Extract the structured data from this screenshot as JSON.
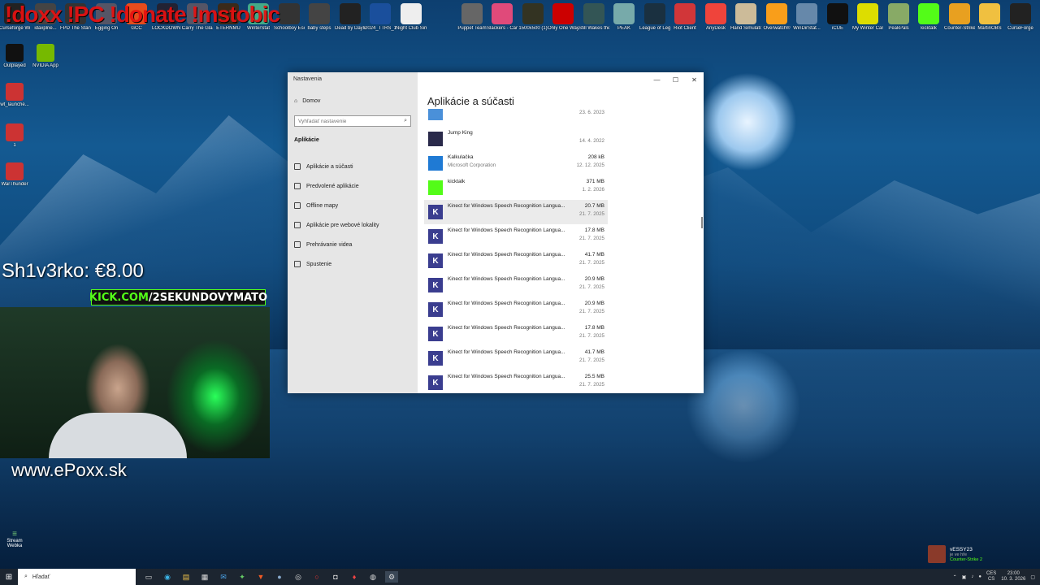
{
  "overlay": {
    "top_text": "!doxx !PC !donate !mstobic",
    "donation": "Sh1v3rko: €8.00",
    "kick_a": "KICK.COM",
    "kick_b": "/2SEKUNDOVYMATO",
    "website": "www.ePoxx.sk"
  },
  "desktop_icons": [
    {
      "label": "Curseforge Windows...",
      "color": "#222"
    },
    {
      "label": "idaxplne...",
      "color": "#444"
    },
    {
      "label": "FPD The Stanle...",
      "color": "#333"
    },
    {
      "label": "Egging On",
      "color": "#556"
    },
    {
      "label": "GCC",
      "color": "#e74c1c"
    },
    {
      "label": "LOCKDOWN Protocol",
      "color": "#223"
    },
    {
      "label": "Carry The Glass",
      "color": "#556"
    },
    {
      "label": "ETERNMU",
      "color": "#3a2a1a"
    },
    {
      "label": "WinterStat",
      "color": "#4a8"
    },
    {
      "label": "Schoolboy Escape 2...",
      "color": "#333"
    },
    {
      "label": "baby steps",
      "color": "#444"
    },
    {
      "label": "Dead by Daylight",
      "color": "#222"
    },
    {
      "label": "2024_TTRS_1",
      "color": "#1a4f9c"
    },
    {
      "label": "Night Club Simulator",
      "color": "#eee"
    },
    {
      "label": "Puppet Team",
      "color": "#666"
    },
    {
      "label": "Slackers - Carts of...",
      "color": "#e04a7a"
    },
    {
      "label": "1500x500 (1)",
      "color": "#332"
    },
    {
      "label": "Only One Way Up",
      "color": "#c00"
    },
    {
      "label": "Still Wakes the Deep",
      "color": "#355"
    },
    {
      "label": "PEAK",
      "color": "#7aa"
    },
    {
      "label": "League of Legends",
      "color": "#1a3040"
    },
    {
      "label": "Riot Client",
      "color": "#d13639"
    },
    {
      "label": "AnyDesk",
      "color": "#ef443b"
    },
    {
      "label": "Hand Simulator",
      "color": "#cb9"
    },
    {
      "label": "Overwatch®",
      "color": "#f99e1a"
    },
    {
      "label": "WinDirStat...",
      "color": "#68a"
    },
    {
      "label": "iCUE",
      "color": "#111"
    },
    {
      "label": "My Winter Car",
      "color": "#dd0"
    },
    {
      "label": "PeakPals",
      "color": "#8a6"
    },
    {
      "label": "kicktalk",
      "color": "#53fc18"
    },
    {
      "label": "Counter-Strike 2",
      "color": "#e8a020"
    },
    {
      "label": "MartinOBS",
      "color": "#f0c040"
    },
    {
      "label": "CurseForge",
      "color": "#222"
    }
  ],
  "left_icons": [
    {
      "label": "Outplayed",
      "color": "#111"
    },
    {
      "label": "NVIDIA App",
      "color": "#76b900"
    },
    {
      "label": "wt_launche...",
      "color": "#c33"
    },
    {
      "label": "1",
      "color": "#c33"
    },
    {
      "label": "WarThunder",
      "color": "#c33"
    }
  ],
  "window": {
    "title": "Nastavenia",
    "home": "Domov",
    "search_placeholder": "Vyhľadať nastavenie",
    "section": "Aplikácie",
    "nav": [
      "Aplikácie a súčasti",
      "Predvolené aplikácie",
      "Offline mapy",
      "Aplikácie pre webové lokality",
      "Prehrávanie videa",
      "Spustenie"
    ],
    "page_title": "Aplikácie a súčasti",
    "minimize": "—",
    "maximize": "☐",
    "close": "✕",
    "apps": [
      {
        "name": "",
        "publisher": "",
        "size": "",
        "date": "23. 6. 2023",
        "icon": "generic-app-icon",
        "color": "#4a90d9"
      },
      {
        "name": "Jump King",
        "publisher": "",
        "size": "",
        "date": "14. 4. 2022",
        "icon": "jump-king-icon",
        "color": "#2a2a4a"
      },
      {
        "name": "Kalkulačka",
        "publisher": "Microsoft Corporation",
        "size": "208 kB",
        "date": "12. 12. 2025",
        "icon": "calculator-icon",
        "color": "#1f7ad4"
      },
      {
        "name": "kicktalk",
        "publisher": "",
        "size": "371 MB",
        "date": "1. 2. 2026",
        "icon": "kicktalk-icon",
        "color": "#53fc18"
      },
      {
        "name": "Kinect for Windows Speech Recognition Langua...",
        "publisher": "",
        "size": "20.7 MB",
        "date": "21. 7. 2025",
        "icon": "kinect-icon",
        "color": "#3a3d8f"
      },
      {
        "name": "Kinect for Windows Speech Recognition Langua...",
        "publisher": "",
        "size": "17.8 MB",
        "date": "21. 7. 2025",
        "icon": "kinect-icon",
        "color": "#3a3d8f"
      },
      {
        "name": "Kinect for Windows Speech Recognition Langua...",
        "publisher": "",
        "size": "41.7 MB",
        "date": "21. 7. 2025",
        "icon": "kinect-icon",
        "color": "#3a3d8f"
      },
      {
        "name": "Kinect for Windows Speech Recognition Langua...",
        "publisher": "",
        "size": "20.9 MB",
        "date": "21. 7. 2025",
        "icon": "kinect-icon",
        "color": "#3a3d8f"
      },
      {
        "name": "Kinect for Windows Speech Recognition Langua...",
        "publisher": "",
        "size": "20.9 MB",
        "date": "21. 7. 2025",
        "icon": "kinect-icon",
        "color": "#3a3d8f"
      },
      {
        "name": "Kinect for Windows Speech Recognition Langua...",
        "publisher": "",
        "size": "17.8 MB",
        "date": "21. 7. 2025",
        "icon": "kinect-icon",
        "color": "#3a3d8f"
      },
      {
        "name": "Kinect for Windows Speech Recognition Langua...",
        "publisher": "",
        "size": "41.7 MB",
        "date": "21. 7. 2025",
        "icon": "kinect-icon",
        "color": "#3a3d8f"
      },
      {
        "name": "Kinect for Windows Speech Recognition Langua...",
        "publisher": "",
        "size": "25.5 MB",
        "date": "21. 7. 2025",
        "icon": "kinect-icon",
        "color": "#3a3d8f"
      }
    ]
  },
  "taskbar": {
    "search_placeholder": "Hľadať",
    "lang1": "CES",
    "lang2": "CS",
    "time": "23:00",
    "date": "10. 3. 2026"
  },
  "notification": {
    "user": "vESSY23",
    "status": "je ve hře",
    "game": "Counter-Strike 2"
  },
  "stream_widget": "Stream Webka"
}
